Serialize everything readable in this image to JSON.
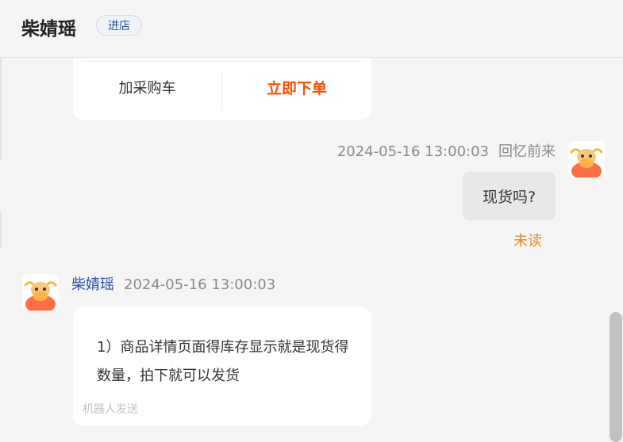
{
  "header": {
    "shop_name": "柴婧瑶",
    "enter_shop_label": "进店"
  },
  "product_card": {
    "add_to_cart_label": "加采购车",
    "buy_now_label": "立即下单"
  },
  "messages": [
    {
      "side": "right",
      "timestamp": "2024-05-16 13:00:03",
      "sender": "回忆前来",
      "text": "现货吗?",
      "status": "未读"
    },
    {
      "side": "left",
      "sender": "柴婧瑶",
      "timestamp": "2024-05-16 13:00:03",
      "text": "1）商品详情页面得库存显示就是现货得数量，拍下就可以发货",
      "footer": "机器人发送"
    }
  ],
  "icons": {
    "avatar": "cow-mascot-avatar"
  },
  "colors": {
    "buy_now": "#ff4d00",
    "unread": "#e48a2a",
    "sender_name_left": "#2a4fa0",
    "enter_shop_text": "#1d4f9b"
  }
}
